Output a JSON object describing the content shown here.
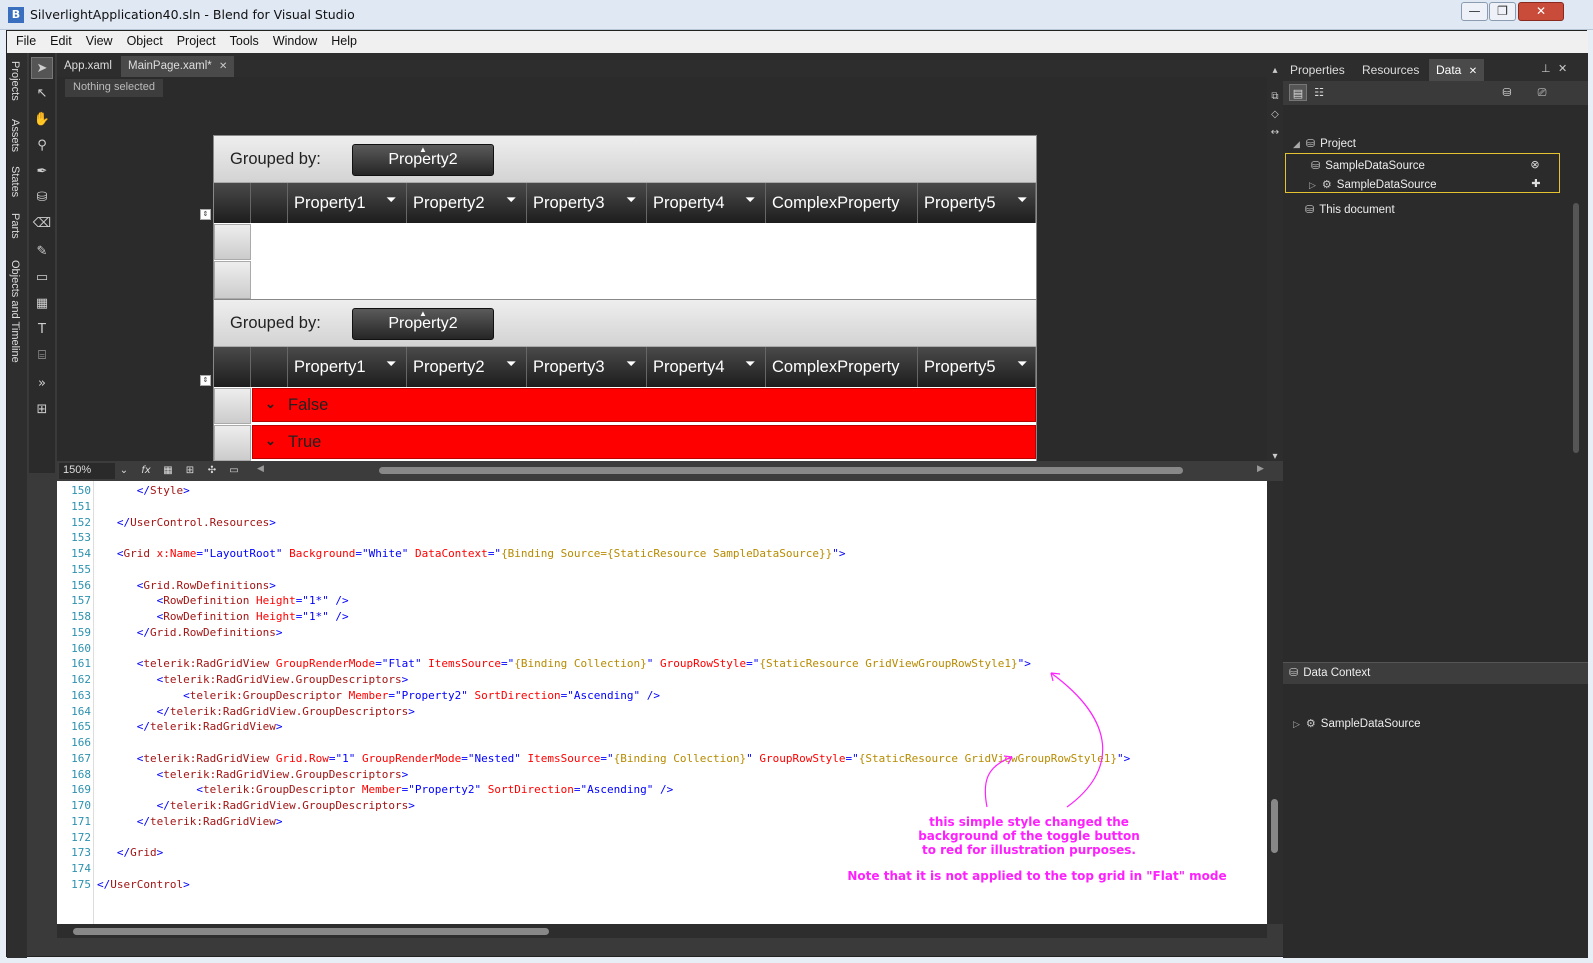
{
  "window": {
    "app_icon": "B",
    "title": "SilverlightApplication40.sln - Blend for Visual Studio",
    "minimize": "—",
    "maximize": "❐",
    "close": "✕"
  },
  "menu": [
    "File",
    "Edit",
    "View",
    "Object",
    "Project",
    "Tools",
    "Window",
    "Help"
  ],
  "left_tabs": [
    "Projects",
    "Assets",
    "States",
    "Parts",
    "Objects and Timeline"
  ],
  "tools": [
    {
      "icon": "selection-arrow-icon",
      "glyph": "➤"
    },
    {
      "icon": "direct-selection-icon",
      "glyph": "↖"
    },
    {
      "icon": "pan-hand-icon",
      "glyph": "✋"
    },
    {
      "icon": "zoom-icon",
      "glyph": "⚲"
    },
    {
      "icon": "eyedropper-icon",
      "glyph": "✒"
    },
    {
      "icon": "paint-bucket-icon",
      "glyph": "⛁"
    },
    {
      "icon": "eraser-icon",
      "glyph": "⌫"
    },
    {
      "icon": "pen-icon",
      "glyph": "✎"
    },
    {
      "icon": "rectangle-icon",
      "glyph": "▭"
    },
    {
      "icon": "grid-icon",
      "glyph": "▦"
    },
    {
      "icon": "text-icon",
      "glyph": "T"
    },
    {
      "icon": "control-icon",
      "glyph": "⌸"
    },
    {
      "icon": "more-tools-icon",
      "glyph": "»"
    },
    {
      "icon": "assets-icon",
      "glyph": "⊞"
    }
  ],
  "doc_tabs": {
    "tab1": "App.xaml",
    "tab2": "MainPage.xaml*",
    "close_glyph": "✕"
  },
  "selection_status": "Nothing selected",
  "grid_top": {
    "grouped_by_label": "Grouped by:",
    "group_chip": "Property2",
    "columns": [
      "Property1",
      "Property2",
      "Property3",
      "Property4",
      "ComplexProperty",
      "Property5"
    ]
  },
  "grid_bottom": {
    "grouped_by_label": "Grouped by:",
    "group_chip": "Property2",
    "columns": [
      "Property1",
      "Property2",
      "Property3",
      "Property4",
      "ComplexProperty",
      "Property5"
    ],
    "group_rows": [
      "False",
      "True"
    ],
    "group_row_color": "#ff0000"
  },
  "status": {
    "zoom": "150%",
    "fx": "fx"
  },
  "code": {
    "line_numbers": [
      "150",
      "151",
      "152",
      "153",
      "154",
      "155",
      "156",
      "157",
      "158",
      "159",
      "160",
      "161",
      "162",
      "163",
      "164",
      "165",
      "166",
      "167",
      "168",
      "169",
      "170",
      "171",
      "172",
      "173",
      "174",
      "175"
    ]
  },
  "annotations": {
    "note1_line1": "this simple style changed the",
    "note1_line2": "background of the toggle button",
    "note1_line3": "to red for illustration purposes.",
    "note2": "Note that it is not applied to the top grid in \"Flat\" mode",
    "color": "#ff20ff"
  },
  "panel": {
    "tabs": [
      "Properties",
      "Resources",
      "Data"
    ],
    "close_glyph": "✕",
    "pin_glyph": "⊥",
    "tree": {
      "project": "Project",
      "sample_source_1": "SampleDataSource",
      "sample_source_2": "SampleDataSource",
      "this_document": "This document"
    },
    "data_context_header": "Data Context",
    "data_context_item": "SampleDataSource"
  }
}
